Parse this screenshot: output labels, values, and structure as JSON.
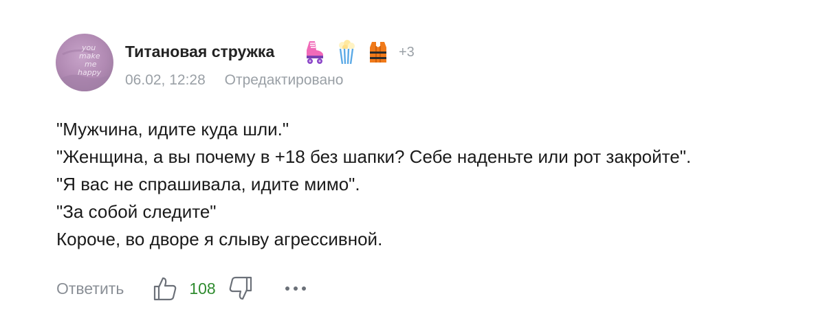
{
  "comment": {
    "author": "Титановая стружка",
    "avatar_text": [
      "you",
      "make",
      "me",
      "happy"
    ],
    "badges": [
      {
        "icon": "roller-skate-icon"
      },
      {
        "icon": "popcorn-icon"
      },
      {
        "icon": "life-vest-icon"
      }
    ],
    "badges_more": "+3",
    "date": "06.02, 12:28",
    "edited": "Отредактировано",
    "lines": [
      "\"Мужчина, идите куда шли.\"",
      "\"Женщина, а вы почему в +18 без шапки? Себе наденьте или рот закройте\".",
      "\"Я вас не спрашивала, идите мимо\".",
      "\"За собой следите\"",
      "Короче, во дворе я слыву агрессивной."
    ],
    "actions": {
      "reply": "Ответить",
      "like_count": "108"
    }
  },
  "colors": {
    "muted": "#9aa0a6",
    "text": "#1a1a1a",
    "like": "#2e8b2e",
    "avatar_bg": "#b38bb3"
  }
}
